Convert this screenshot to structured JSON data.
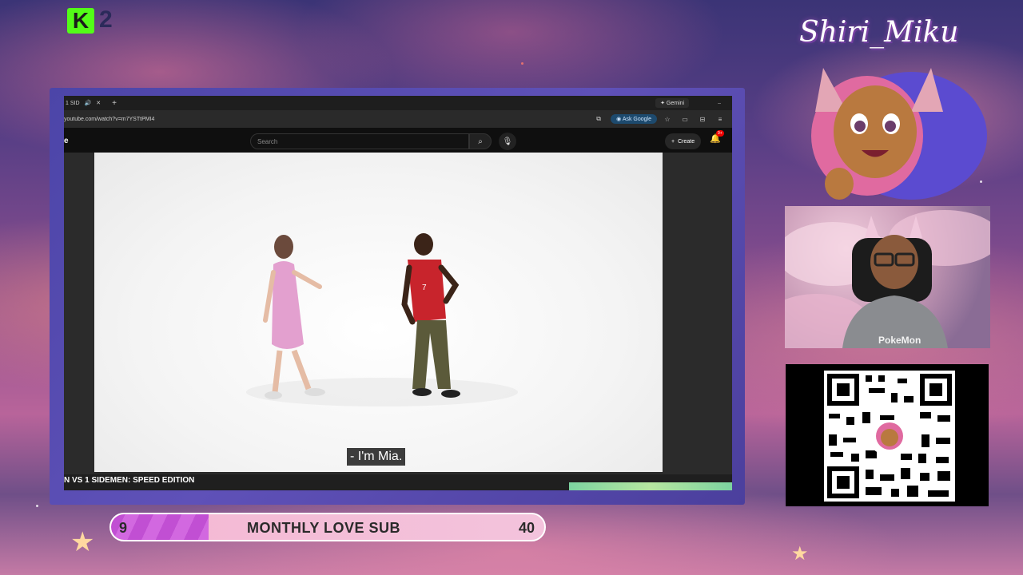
{
  "overlay": {
    "kick_logo": "K",
    "corner_number": "2",
    "streamer_name": "Shiri_Miku"
  },
  "browser": {
    "tab_title": "1 SID",
    "gemini_label": "Gemini",
    "url": "youtube.com/watch?v=m7YSTtPMI4",
    "ask_google_label": "Ask Google"
  },
  "youtube": {
    "logo": "e",
    "search_placeholder": "Search",
    "create_label": "Create",
    "notifications_badge": "9+",
    "subtitle": "- I'm Mia.",
    "video_title": "N VS 1 SIDEMEN: SPEED EDITION"
  },
  "goal_bar": {
    "current": "9",
    "label": "MONTHLY LOVE SUB",
    "target": "40",
    "progress_fraction": 0.225
  },
  "webcam": {
    "shirt_text": "PokeMon"
  }
}
